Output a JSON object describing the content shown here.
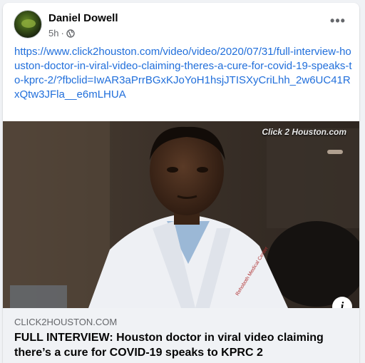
{
  "post": {
    "author": "Daniel Dowell",
    "time": "5h",
    "separator": "·",
    "privacy_icon": "globe-icon",
    "more_icon": "more-horizontal-icon",
    "more_glyph": "•••",
    "text": "https://www.click2houston.com/video/video/2020/07/31/full-interview-houston-doctor-in-viral-video-claiming-theres-a-cure-for-covid-19-speaks-to-kprc-2/?fbclid=IwAR3aPrrBGxKJoYoH1hsjJTISXyCriLhh_2w6UC41RxQtw3JFla__e6mLHUA"
  },
  "media": {
    "watermark": "Click 2 Houston.com",
    "info_glyph": "i"
  },
  "link_preview": {
    "domain": "CLICK2HOUSTON.COM",
    "title": "FULL INTERVIEW: Houston doctor in viral video claiming there’s a cure for COVID-19 speaks to KPRC 2"
  },
  "colors": {
    "link": "#216fdb",
    "secondary_text": "#65676b",
    "primary_text": "#050505"
  }
}
